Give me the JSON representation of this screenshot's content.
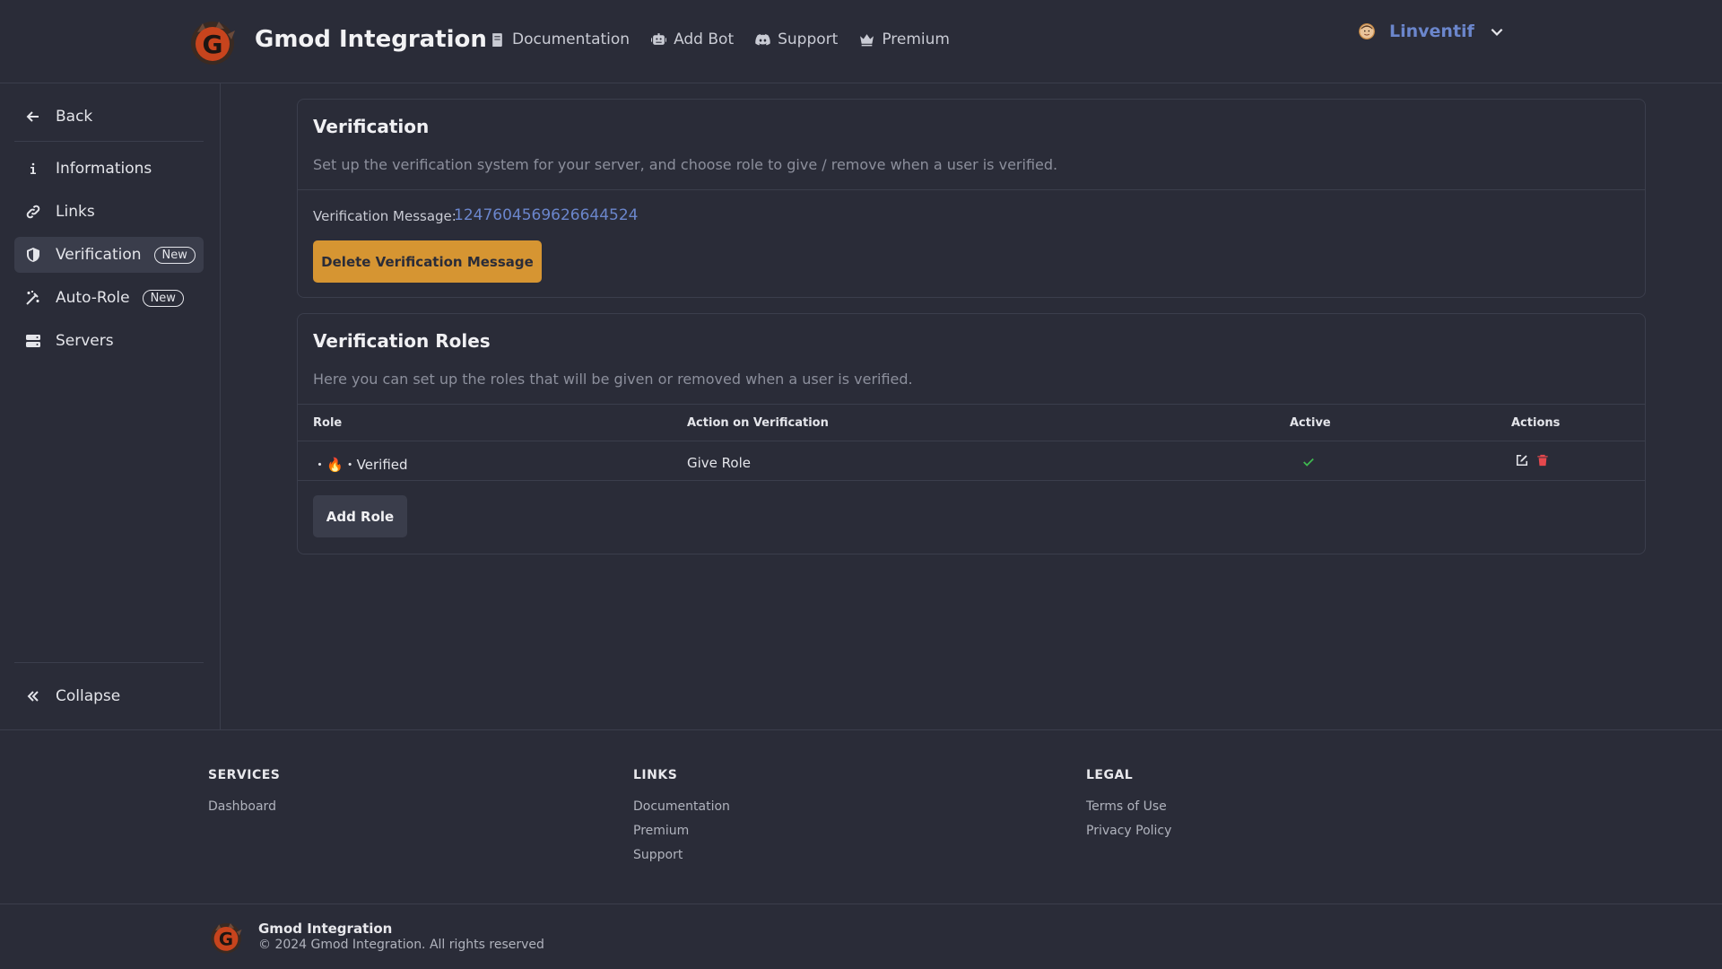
{
  "header": {
    "brand": "Gmod Integration",
    "nav": [
      {
        "label": "Documentation",
        "icon": "book-icon"
      },
      {
        "label": "Add Bot",
        "icon": "robot-icon"
      },
      {
        "label": "Support",
        "icon": "discord-icon"
      },
      {
        "label": "Premium",
        "icon": "crown-icon"
      }
    ],
    "user": {
      "name": "Linventif"
    }
  },
  "sidebar": {
    "back": "Back",
    "items": [
      {
        "label": "Informations",
        "icon": "info-icon"
      },
      {
        "label": "Links",
        "icon": "link-icon"
      },
      {
        "label": "Verification",
        "icon": "shield-icon",
        "badge": "New",
        "active": true
      },
      {
        "label": "Auto-Role",
        "icon": "magic-wand-icon",
        "badge": "New"
      },
      {
        "label": "Servers",
        "icon": "server-icon"
      }
    ],
    "collapse": "Collapse"
  },
  "verification": {
    "title": "Verification",
    "description": "Set up the verification system for your server, and choose role to give / remove when a user is verified.",
    "message_label": "Verification Message:",
    "message_id": "1247604569626644524",
    "delete_button": "Delete Verification Message"
  },
  "roles": {
    "title": "Verification Roles",
    "description": "Here you can set up the roles that will be given or removed when a user is verified.",
    "columns": [
      "Role",
      "Action on Verification",
      "Active",
      "Actions"
    ],
    "rows": [
      {
        "role": "・🔥・Verified",
        "action": "Give Role",
        "active": true
      }
    ],
    "add_button": "Add Role"
  },
  "footer": {
    "services": {
      "heading": "SERVICES",
      "links": [
        "Dashboard"
      ]
    },
    "links": {
      "heading": "LINKS",
      "links": [
        "Documentation",
        "Premium",
        "Support"
      ]
    },
    "legal": {
      "heading": "LEGAL",
      "links": [
        "Terms of Use",
        "Privacy Policy"
      ]
    },
    "brand": "Gmod Integration",
    "copyright": "© 2024 Gmod Integration. All rights reserved"
  },
  "colors": {
    "background": "#2a2c38",
    "accent": "#6b86cc",
    "warning_button": "#d69532",
    "success": "#3fb950",
    "danger": "#e5484d"
  }
}
